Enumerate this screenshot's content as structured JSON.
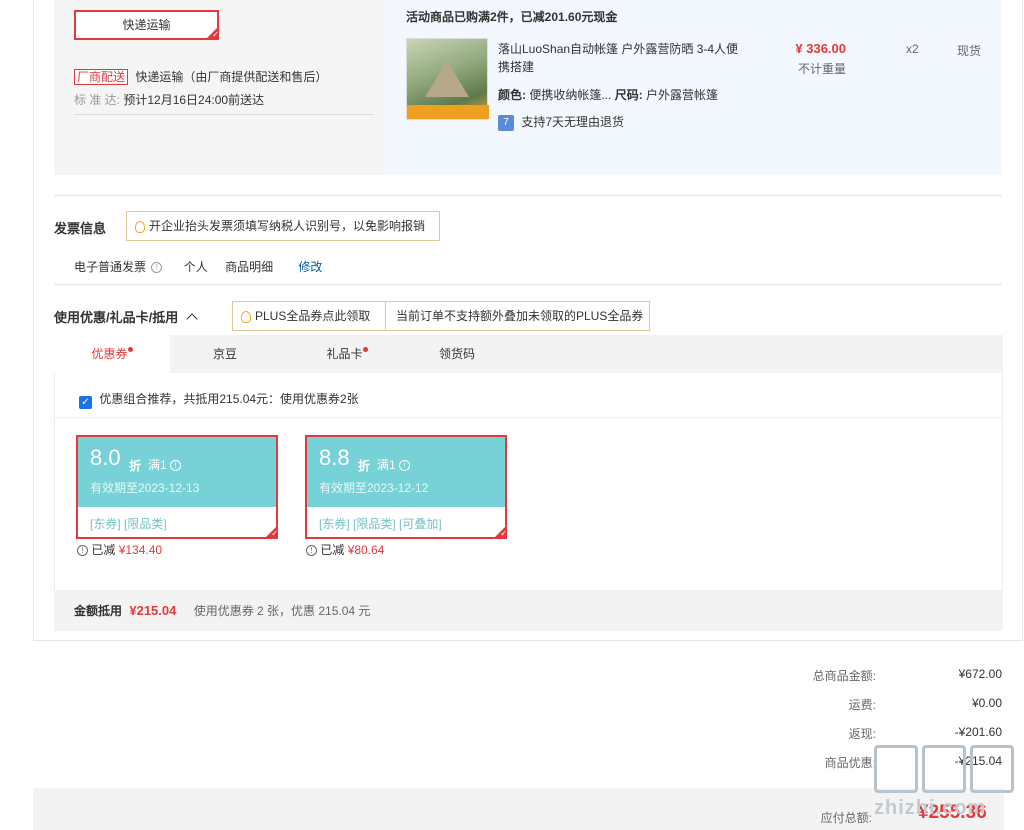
{
  "shipping": {
    "method_button": "快递运输",
    "vendor_tag": "厂商配送",
    "vendor_text": "快递运输（由厂商提供配送和售后）",
    "standard_label": "标 准 达:",
    "standard_text": "预计12月16日24:00前送达"
  },
  "promo": {
    "header": "活动商品已购满2件，已减201.60元现金"
  },
  "product": {
    "title": "落山LuoShan自动帐篷 户外露营防晒 3-4人便携搭建",
    "color_label": "颜色:",
    "color_value": "便携收纳帐篷...",
    "size_label": "尺码:",
    "size_value": "户外露营帐篷",
    "price": "¥ 336.00",
    "weight_note": "不计重量",
    "quantity": "x2",
    "stock": "现货",
    "return_icon": "7",
    "return_policy": "支持7天无理由退货"
  },
  "invoice": {
    "title": "发票信息",
    "tip": "开企业抬头发票须填写纳税人识别号，以免影响报销",
    "type": "电子普通发票",
    "receiver": "个人",
    "content": "商品明细",
    "edit": "修改"
  },
  "discount": {
    "title": "使用优惠/礼品卡/抵用",
    "plus_tip": "PLUS全品券点此领取",
    "plus_note": "当前订单不支持额外叠加未领取的PLUS全品券",
    "tabs": [
      {
        "label": "优惠券"
      },
      {
        "label": "京豆"
      },
      {
        "label": "礼品卡"
      },
      {
        "label": "领货码"
      }
    ],
    "recommend": "优惠组合推荐，共抵用215.04元：使用优惠券2张",
    "coupons": [
      {
        "value": "8.0",
        "unit": "折",
        "condition": "满1",
        "expiry": "有效期至2023-12-13",
        "tags": "[东券]  [限品类]",
        "saved_label": "已减",
        "saved": "¥134.40"
      },
      {
        "value": "8.8",
        "unit": "折",
        "condition": "满1",
        "expiry": "有效期至2023-12-12",
        "tags": "[东券]  [限品类]  [可叠加]",
        "saved_label": "已减",
        "saved": "¥80.64"
      }
    ],
    "summary_label": "金额抵用",
    "summary_amount": "¥215.04",
    "summary_text": "使用优惠券 2 张，优惠 215.04 元"
  },
  "totals": {
    "goods_label": "总商品金额:",
    "goods_value": "¥672.00",
    "freight_label": "运费:",
    "freight_value": "¥0.00",
    "cashback_label": "返现:",
    "cashback_value": "-¥201.60",
    "coupon_label": "商品优惠:",
    "coupon_value": "-¥215.04",
    "payable_label": "应付总额:",
    "payable_value": "¥255.36"
  },
  "watermark": {
    "text": "zhizhi.com"
  },
  "colors": {
    "accent": "#e4393c",
    "coupon": "#76d2d6",
    "link": "#005ea7"
  }
}
